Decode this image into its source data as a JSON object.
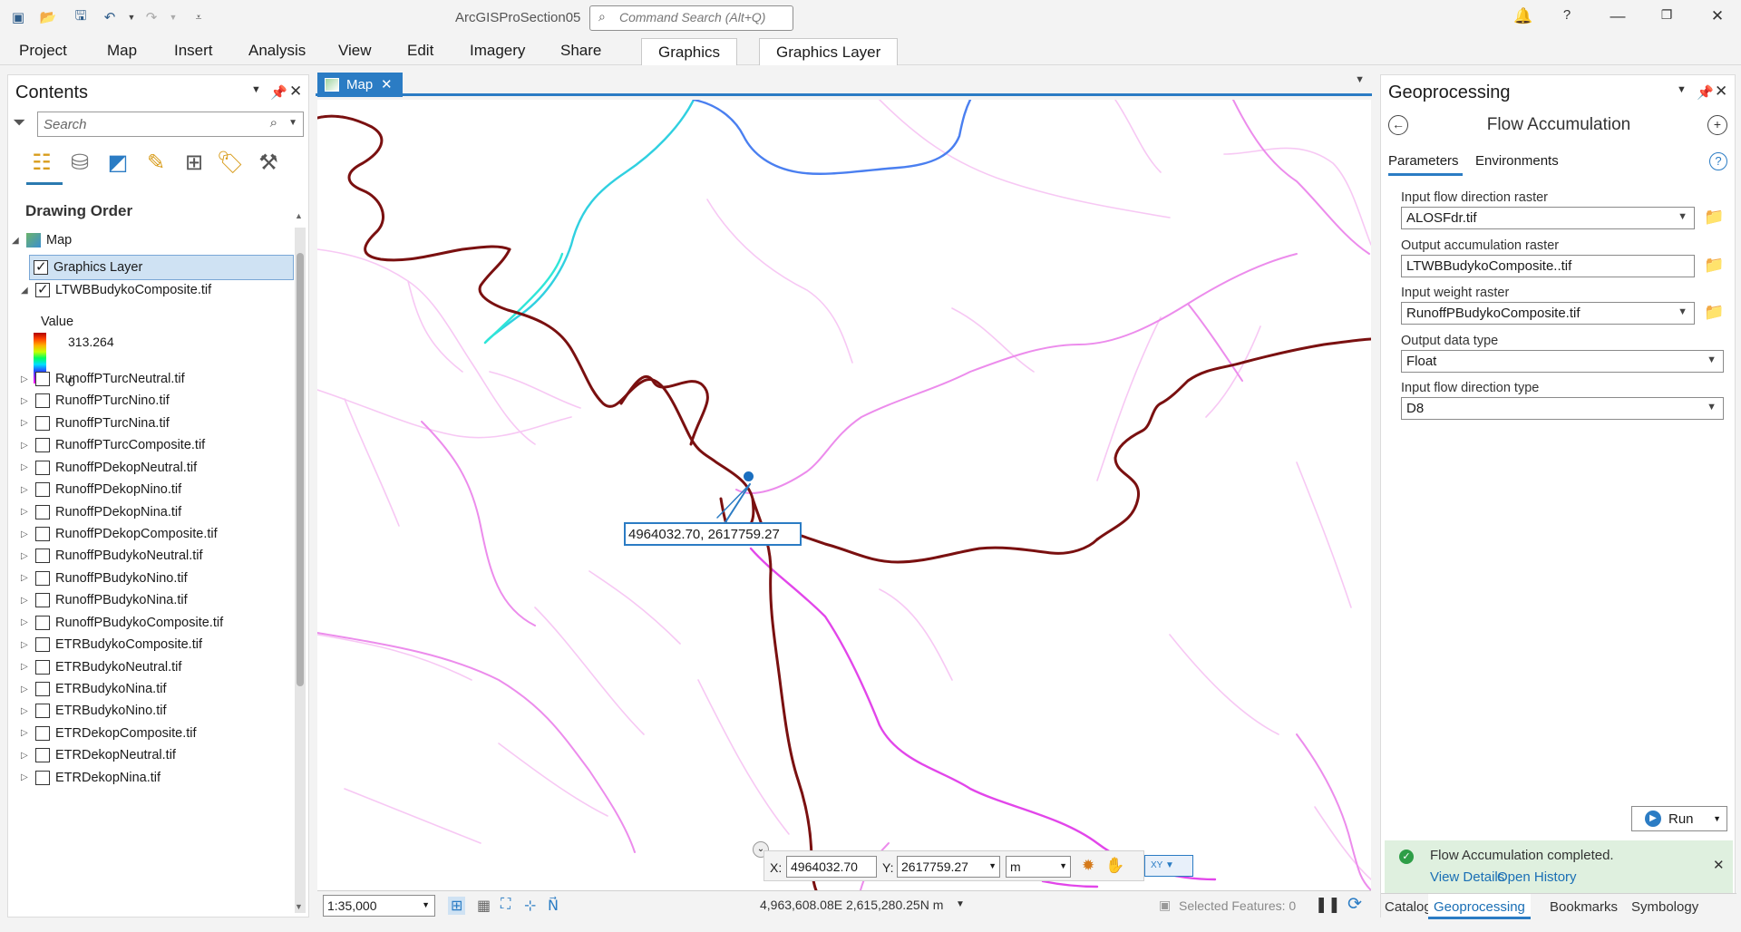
{
  "app": {
    "title": "ArcGISProSection05",
    "command_search_placeholder": "Command Search (Alt+Q)"
  },
  "ribbon": {
    "tabs": [
      "Project",
      "Map",
      "Insert",
      "Analysis",
      "View",
      "Edit",
      "Imagery",
      "Share"
    ],
    "contextual_tabs": [
      "Graphics",
      "Graphics Layer"
    ]
  },
  "contents": {
    "title": "Contents",
    "search_placeholder": "Search",
    "section": "Drawing Order",
    "map_label": "Map",
    "graphics_layer": "Graphics Layer",
    "active_layer": "LTWBBudykoComposite.tif",
    "legend": {
      "title": "Value",
      "high": "313.264",
      "low": "0"
    },
    "layers": [
      "RunoffPTurcNeutral.tif",
      "RunoffPTurcNino.tif",
      "RunoffPTurcNina.tif",
      "RunoffPTurcComposite.tif",
      "RunoffPDekopNeutral.tif",
      "RunoffPDekopNino.tif",
      "RunoffPDekopNina.tif",
      "RunoffPDekopComposite.tif",
      "RunoffPBudykoNeutral.tif",
      "RunoffPBudykoNino.tif",
      "RunoffPBudykoNina.tif",
      "RunoffPBudykoComposite.tif",
      "ETRBudykoComposite.tif",
      "ETRBudykoNeutral.tif",
      "ETRBudykoNina.tif",
      "ETRBudykoNino.tif",
      "ETRDekopComposite.tif",
      "ETRDekopNeutral.tif",
      "ETRDekopNina.tif"
    ]
  },
  "map": {
    "tab_label": "Map",
    "point_label": "4964032.70, 2617759.27",
    "coord_bar": {
      "x_label": "X:",
      "x_value": "4964032.70",
      "y_label": "Y:",
      "y_value": "2617759.27",
      "unit": "m"
    },
    "scale": "1:35,000",
    "cursor_coords": "4,963,608.08E 2,615,280.25N m",
    "selected_features": "Selected Features: 0"
  },
  "geoprocessing": {
    "title": "Geoprocessing",
    "tool": "Flow Accumulation",
    "tabs": [
      "Parameters",
      "Environments"
    ],
    "params": [
      {
        "label": "Input flow direction raster",
        "value": "ALOSFdr.tif"
      },
      {
        "label": "Output accumulation raster",
        "value": "LTWBBudykoComposite..tif"
      },
      {
        "label": "Input weight raster",
        "value": "RunoffPBudykoComposite.tif"
      },
      {
        "label": "Output data type",
        "value": "Float"
      },
      {
        "label": "Input flow direction type",
        "value": "D8"
      }
    ],
    "run_label": "Run",
    "message": "Flow Accumulation completed.",
    "view_details": "View Details",
    "open_history": "Open History"
  },
  "bottom_tabs": [
    "Catalog",
    "Geoprocessing",
    "Bookmarks",
    "Symbology"
  ]
}
